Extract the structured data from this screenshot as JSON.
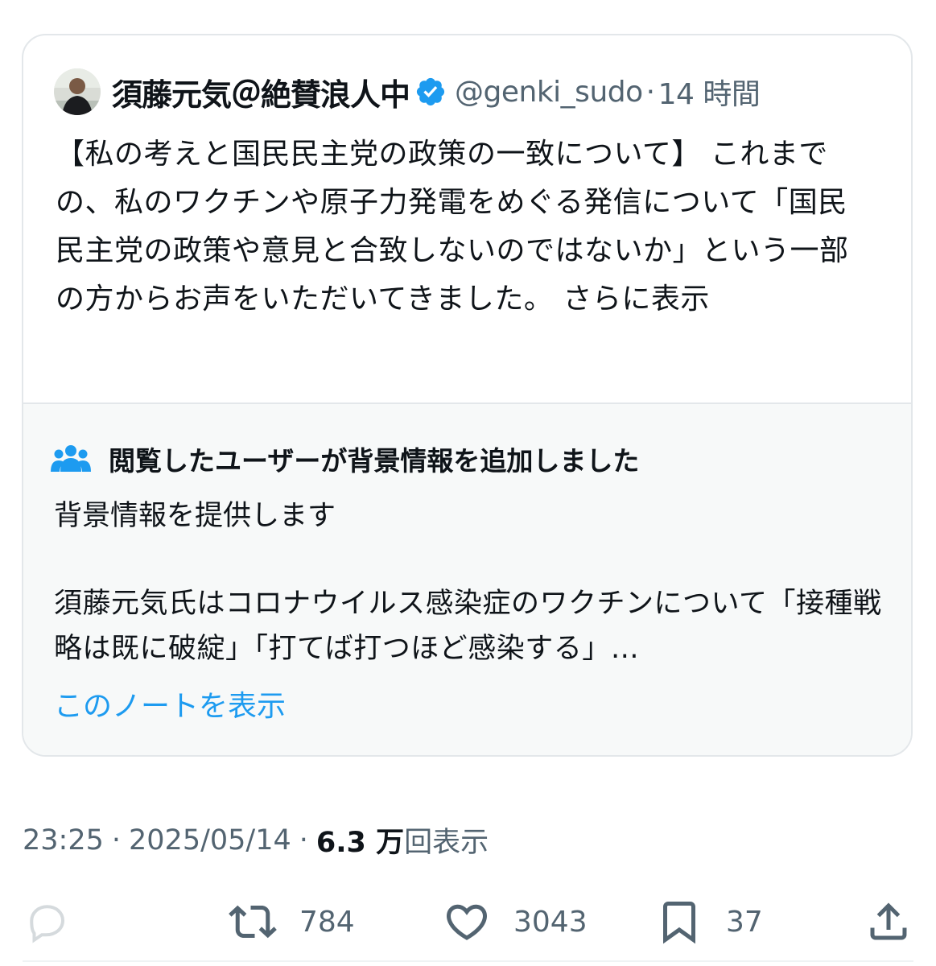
{
  "quote": {
    "display_name": "須藤元気＠絶賛浪人中",
    "handle": "@genki_sudo",
    "separator": "·",
    "time_ago": "14 時間",
    "text": "【私の考えと国民民主党の政策の一致について】 これまでの、私のワクチンや原子力発電をめぐる発信について「国民民主党の政策や意見と合致しないのではないか」という一部の方からお声をいただいてきました。",
    "show_more": "さらに表示"
  },
  "community_note": {
    "title": "閲覧したユーザーが背景情報を追加しました",
    "subtitle": "背景情報を提供します",
    "body": "須藤元気氏はコロナウイルス感染症のワクチンについて「接種戦略は既に破綻」「打てば打つほど感染する」…",
    "link": "このノートを表示"
  },
  "meta": {
    "time": "23:25",
    "dot": "·",
    "date": "2025/05/14",
    "views_count": "6.3 万",
    "views_label": "回表示"
  },
  "actions": {
    "retweets": "784",
    "likes": "3043",
    "bookmarks": "37"
  },
  "colors": {
    "accent": "#1d9bf0",
    "secondary_text": "#536471",
    "primary_text": "#0f1419",
    "note_background": "#f7f9f9"
  },
  "icons": [
    "verified-badge-icon",
    "people-icon",
    "reply-icon",
    "retweet-icon",
    "heart-icon",
    "bookmark-icon",
    "share-icon"
  ]
}
